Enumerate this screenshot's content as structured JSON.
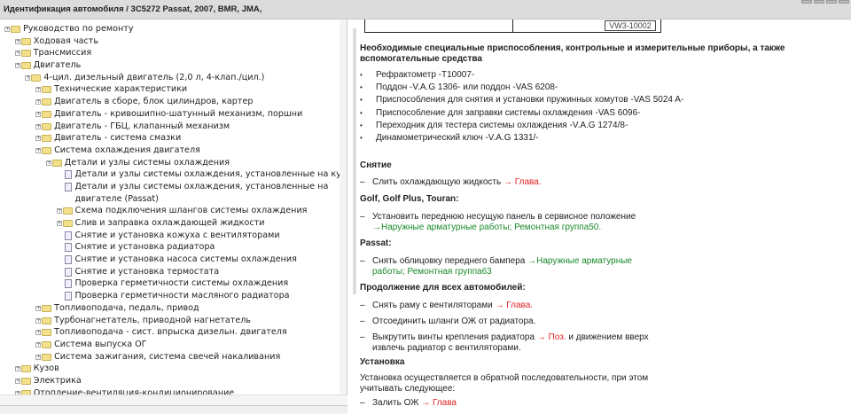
{
  "title": "Идентификация автомобиля / 3C5272 Passat, 2007, BMR, JMA,",
  "tree": [
    {
      "label": "Руководство по ремонту",
      "level": 0,
      "type": "folder"
    },
    {
      "label": "Ходовая часть",
      "level": 1,
      "type": "folder"
    },
    {
      "label": "Трансмиссия",
      "level": 1,
      "type": "folder"
    },
    {
      "label": "Двигатель",
      "level": 1,
      "type": "folder"
    },
    {
      "label": "4-цил. дизельный двигатель (2,0 л, 4-клап./цил.)",
      "level": 2,
      "type": "folder"
    },
    {
      "label": "Технические характеристики",
      "level": 3,
      "type": "folder"
    },
    {
      "label": "Двигатель в сборе, блок цилиндров, картер",
      "level": 3,
      "type": "folder"
    },
    {
      "label": "Двигатель - кривошипно-шатунный механизм, поршни",
      "level": 3,
      "type": "folder"
    },
    {
      "label": "Двигатель - ГБЦ, клапанный механизм",
      "level": 3,
      "type": "folder"
    },
    {
      "label": "Двигатель - система смазки",
      "level": 3,
      "type": "folder"
    },
    {
      "label": "Система охлаждения двигателя",
      "level": 3,
      "type": "folder"
    },
    {
      "label": "Детали и узлы системы охлаждения",
      "level": 4,
      "type": "folder"
    },
    {
      "label": "Детали и узлы системы охлаждения, установленные на кузове",
      "level": 5,
      "type": "doc"
    },
    {
      "label": "Детали и узлы системы охлаждения, установленные на двигателе (Passat)",
      "level": 5,
      "type": "doc",
      "tall": true
    },
    {
      "label": "Схема подключения шлангов системы охлаждения",
      "level": 5,
      "type": "folder"
    },
    {
      "label": "Слив и заправка охлаждающей жидкости",
      "level": 5,
      "type": "folder"
    },
    {
      "label": "Снятие и установка кожуха с вентиляторами",
      "level": 5,
      "type": "doc"
    },
    {
      "label": "Снятие и установка радиатора",
      "level": 5,
      "type": "doc"
    },
    {
      "label": "Снятие и установка насоса системы охлаждения",
      "level": 5,
      "type": "doc"
    },
    {
      "label": "Снятие и установка термостата",
      "level": 5,
      "type": "doc"
    },
    {
      "label": "Проверка герметичности системы охлаждения",
      "level": 5,
      "type": "doc"
    },
    {
      "label": "Проверка герметичности масляного радиатора",
      "level": 5,
      "type": "doc"
    },
    {
      "label": "Топливоподача, педаль, привод",
      "level": 3,
      "type": "folder"
    },
    {
      "label": "Турбонагнетатель, приводной нагнетатель",
      "level": 3,
      "type": "folder"
    },
    {
      "label": "Топливоподача - сист. впрыска дизельн. двигателя",
      "level": 3,
      "type": "folder"
    },
    {
      "label": "Система выпуска ОГ",
      "level": 3,
      "type": "folder"
    },
    {
      "label": "Система зажигания, система свечей накаливания",
      "level": 3,
      "type": "folder"
    },
    {
      "label": "Кузов",
      "level": 1,
      "type": "folder"
    },
    {
      "label": "Электрика",
      "level": 1,
      "type": "folder"
    },
    {
      "label": "Отопление-вентиляция-кондиционирование",
      "level": 1,
      "type": "folder"
    }
  ],
  "content": {
    "table_code": "VW3-10002",
    "tools_heading": "Необходимые специальные приспособления, контрольные и измерительные приборы, а также вспомогательные средства",
    "tools": [
      "Рефрактометр -T10007-",
      "Поддон -V.A.G 1306- или поддон -VAS 6208-",
      "Приспособления для снятия и установки пружинных хомутов -VAS 5024 A-",
      "Приспособление для заправки системы охлаждения -VAS 6096-",
      "Переходник для тестера системы охлаждения -V.A.G 1274/8-",
      "Динамометрический ключ -V.A.G 1331/-"
    ],
    "removal_heading": "Снятие",
    "step1": "Слить охлаждающую жидкость",
    "link_glava": "→ Глава.",
    "golf_heading": "Golf, Golf Plus, Touran:",
    "step2": "Установить переднюю несущую панель в сервисное положение",
    "step2_link": "→Наружные арматурные работы; Ремонтная группа50.",
    "passat_heading": "Passat:",
    "step3": "Снять облицовку переднего бампера",
    "step3_link": "→Наружные арматурные работы; Ремонтная группа63",
    "all_heading": "Продолжение для всех автомобилей:",
    "step4": "Снять раму с вентиляторами",
    "step5": "Отсоединить шланги ОЖ от радиатора.",
    "step6a": "Выкрутить винты крепления радиатора",
    "step6_link": "→ Поз.",
    "step6b": "и движением вверх извлечь радиатор с вентиляторами.",
    "install_heading": "Установка",
    "install_text": "Установка осуществляется в обратной последовательности, при этом учитывать следующее:",
    "step7": "Залить ОЖ",
    "step7_link": "→ Глава",
    "dash": "–"
  }
}
